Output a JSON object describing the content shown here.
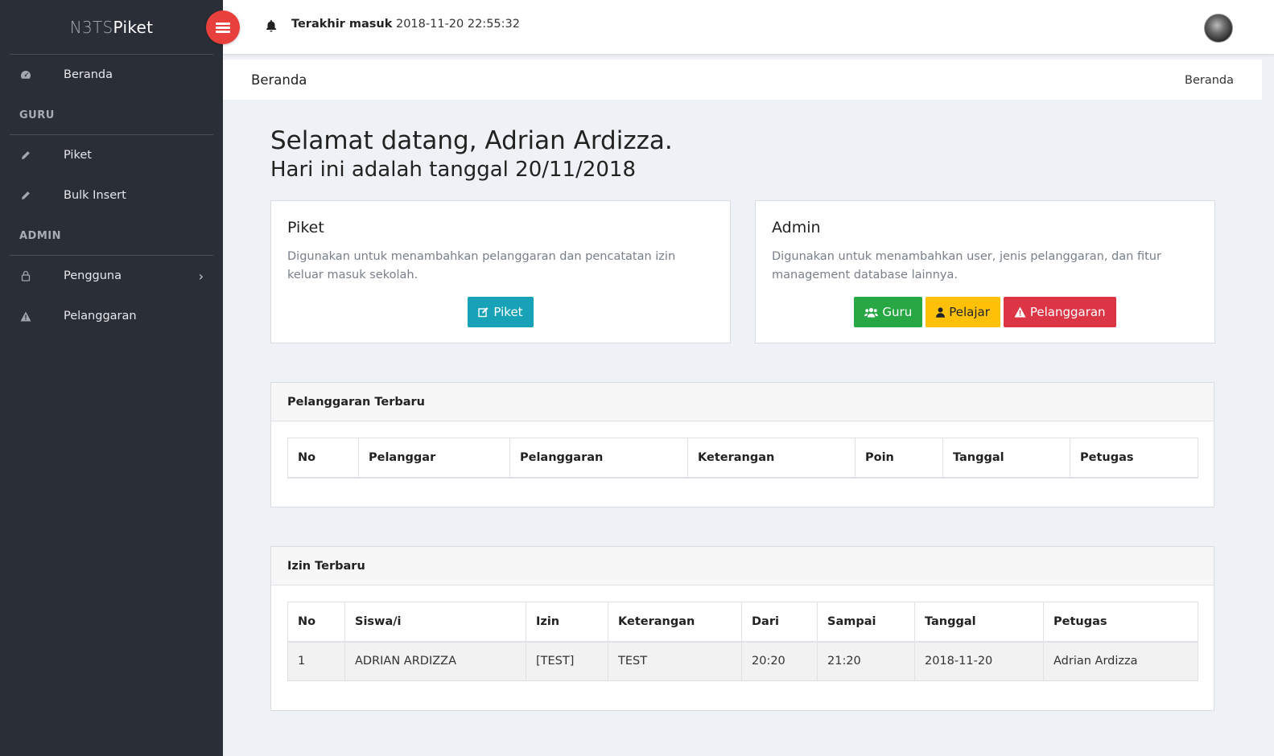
{
  "sidebar": {
    "brand_thin": "N3TS",
    "brand_bold": "Piket",
    "items_top": [
      {
        "label": "Beranda",
        "icon": "dashboard-icon"
      }
    ],
    "section_guru": "GURU",
    "items_guru": [
      {
        "label": "Piket",
        "icon": "pencil-icon"
      },
      {
        "label": "Bulk Insert",
        "icon": "pencil-icon"
      }
    ],
    "section_admin": "ADMIN",
    "items_admin": [
      {
        "label": "Pengguna",
        "icon": "user-icon",
        "chevron": "›"
      },
      {
        "label": "Pelanggaran",
        "icon": "warning-icon"
      }
    ]
  },
  "header": {
    "last_login_label": "Terakhir masuk",
    "last_login_value": "2018-11-20 22:55:32"
  },
  "breadcrumb": {
    "title": "Beranda",
    "crumb": "Beranda"
  },
  "welcome": {
    "greeting": "Selamat datang, Adrian Ardizza.",
    "date_line": "Hari ini adalah tanggal 20/11/2018"
  },
  "cards": {
    "piket": {
      "title": "Piket",
      "desc": "Digunakan untuk menambahkan pelanggaran dan pencatatan izin keluar masuk sekolah.",
      "button": "Piket"
    },
    "admin": {
      "title": "Admin",
      "desc": "Digunakan untuk menambahkan user, jenis pelanggaran, dan fitur management database lainnya.",
      "buttons": {
        "guru": "Guru",
        "pelajar": "Pelajar",
        "pelanggaran": "Pelanggaran"
      }
    }
  },
  "pelanggaran_panel": {
    "title": "Pelanggaran Terbaru",
    "columns": [
      "No",
      "Pelanggar",
      "Pelanggaran",
      "Keterangan",
      "Poin",
      "Tanggal",
      "Petugas"
    ]
  },
  "izin_panel": {
    "title": "Izin Terbaru",
    "columns": [
      "No",
      "Siswa/i",
      "Izin",
      "Keterangan",
      "Dari",
      "Sampai",
      "Tanggal",
      "Petugas"
    ],
    "rows": [
      [
        "1",
        "ADRIAN ARDIZZA",
        "[TEST]",
        "TEST",
        "20:20",
        "21:20",
        "2018-11-20",
        "Adrian Ardizza"
      ]
    ]
  },
  "colors": {
    "sidebar_bg": "#2a2e36",
    "toggle": "#e8403d",
    "info": "#17a2b8",
    "success": "#28a745",
    "warning": "#ffc107",
    "danger": "#dc3545"
  }
}
